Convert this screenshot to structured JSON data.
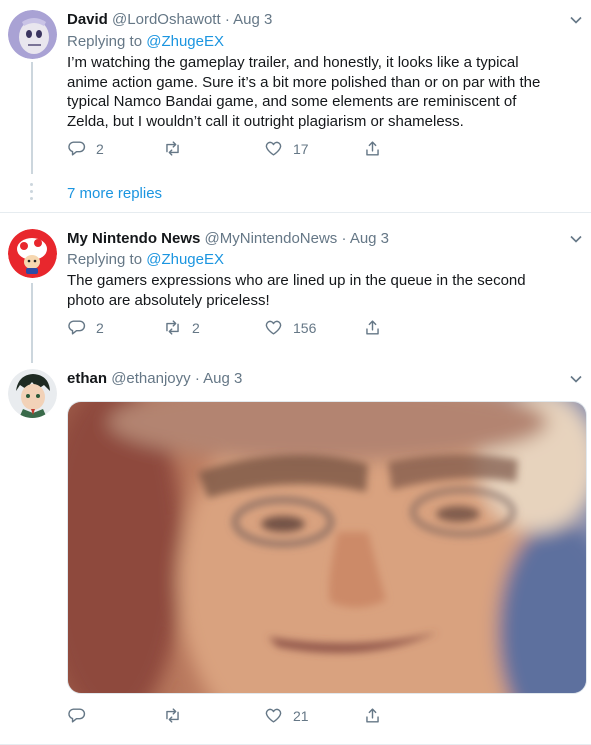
{
  "tweets": [
    {
      "name": "David",
      "handle": "@LordOshawott",
      "sep": "·",
      "date": "Aug 3",
      "replying_prefix": "Replying to",
      "replying_to": "@ZhugeEX",
      "lines": [
        "I’m watching the gameplay trailer, and honestly, it looks like a typical",
        "anime action game. Sure it’s a bit more polished than or on par with the",
        "typical Namco Bandai game, and some elements are reminiscent of",
        "Zelda, but I wouldn’t call it outright plagiarism or shameless."
      ],
      "reply_count": "2",
      "retweet_count": "",
      "like_count": "17",
      "more_replies": "7 more replies"
    },
    {
      "name": "My Nintendo News",
      "handle": "@MyNintendoNews",
      "sep": "·",
      "date": "Aug 3",
      "replying_prefix": "Replying to",
      "replying_to": "@ZhugeEX",
      "lines": [
        "The gamers expressions who are lined up in the queue in the second",
        "photo are absolutely priceless!"
      ],
      "reply_count": "2",
      "retweet_count": "2",
      "like_count": "156"
    },
    {
      "name": "ethan",
      "handle": "@ethanjoyy",
      "sep": "·",
      "date": "Aug 3",
      "reply_count": "",
      "retweet_count": "",
      "like_count": "21"
    }
  ],
  "colors": {
    "link": "#1b95e0",
    "muted": "#657786",
    "thread_line": "#ccd6dd"
  },
  "icons": [
    "reply-icon",
    "retweet-icon",
    "like-icon",
    "share-icon",
    "chevron-down-icon"
  ]
}
